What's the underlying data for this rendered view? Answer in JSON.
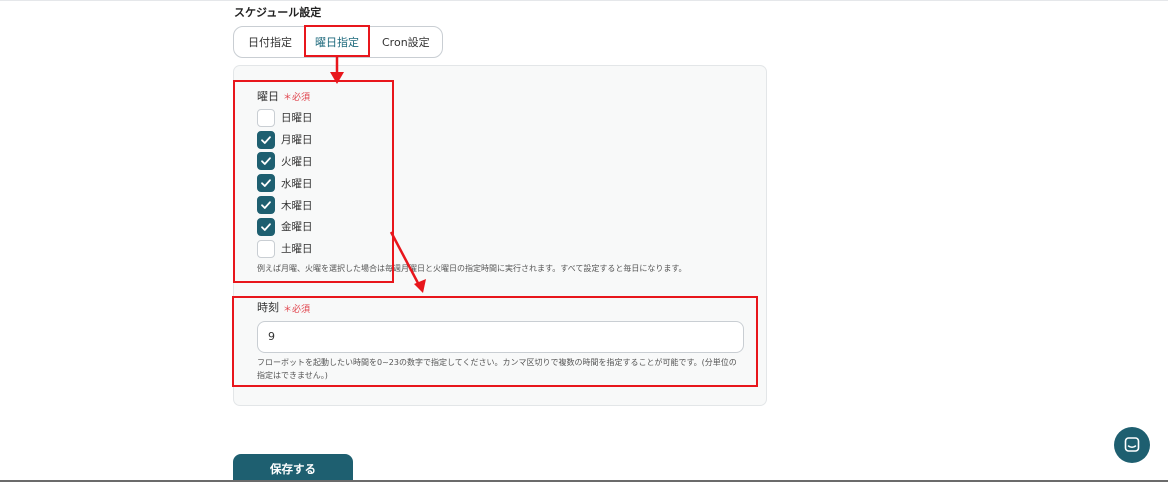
{
  "section_title": "スケジュール設定",
  "tabs": [
    {
      "label": "日付指定",
      "active": false
    },
    {
      "label": "曜日指定",
      "active": true
    },
    {
      "label": "Cron設定",
      "active": false
    }
  ],
  "weekday": {
    "label": "曜日",
    "required": "＊必須",
    "days": [
      {
        "label": "日曜日",
        "checked": false
      },
      {
        "label": "月曜日",
        "checked": true
      },
      {
        "label": "火曜日",
        "checked": true
      },
      {
        "label": "水曜日",
        "checked": true
      },
      {
        "label": "木曜日",
        "checked": true
      },
      {
        "label": "金曜日",
        "checked": true
      },
      {
        "label": "土曜日",
        "checked": false
      }
    ],
    "help": "例えば月曜、火曜を選択した場合は毎週月曜日と火曜日の指定時間に実行されます。すべて設定すると毎日になります。"
  },
  "time": {
    "label": "時刻",
    "required": "＊必須",
    "value": "9",
    "help_line1": "フローボットを起動したい時間を0~23の数字で指定してください。カンマ区切りで複数の時間を指定することが可能です。(分単位の",
    "help_line2": "指定はできません。)"
  },
  "save_button": "保存する",
  "colors": {
    "accent": "#1e5f70",
    "required": "#e0414a",
    "annotation": "#e8161c"
  },
  "icons": {
    "check": "check-icon",
    "chat": "chat-icon"
  }
}
